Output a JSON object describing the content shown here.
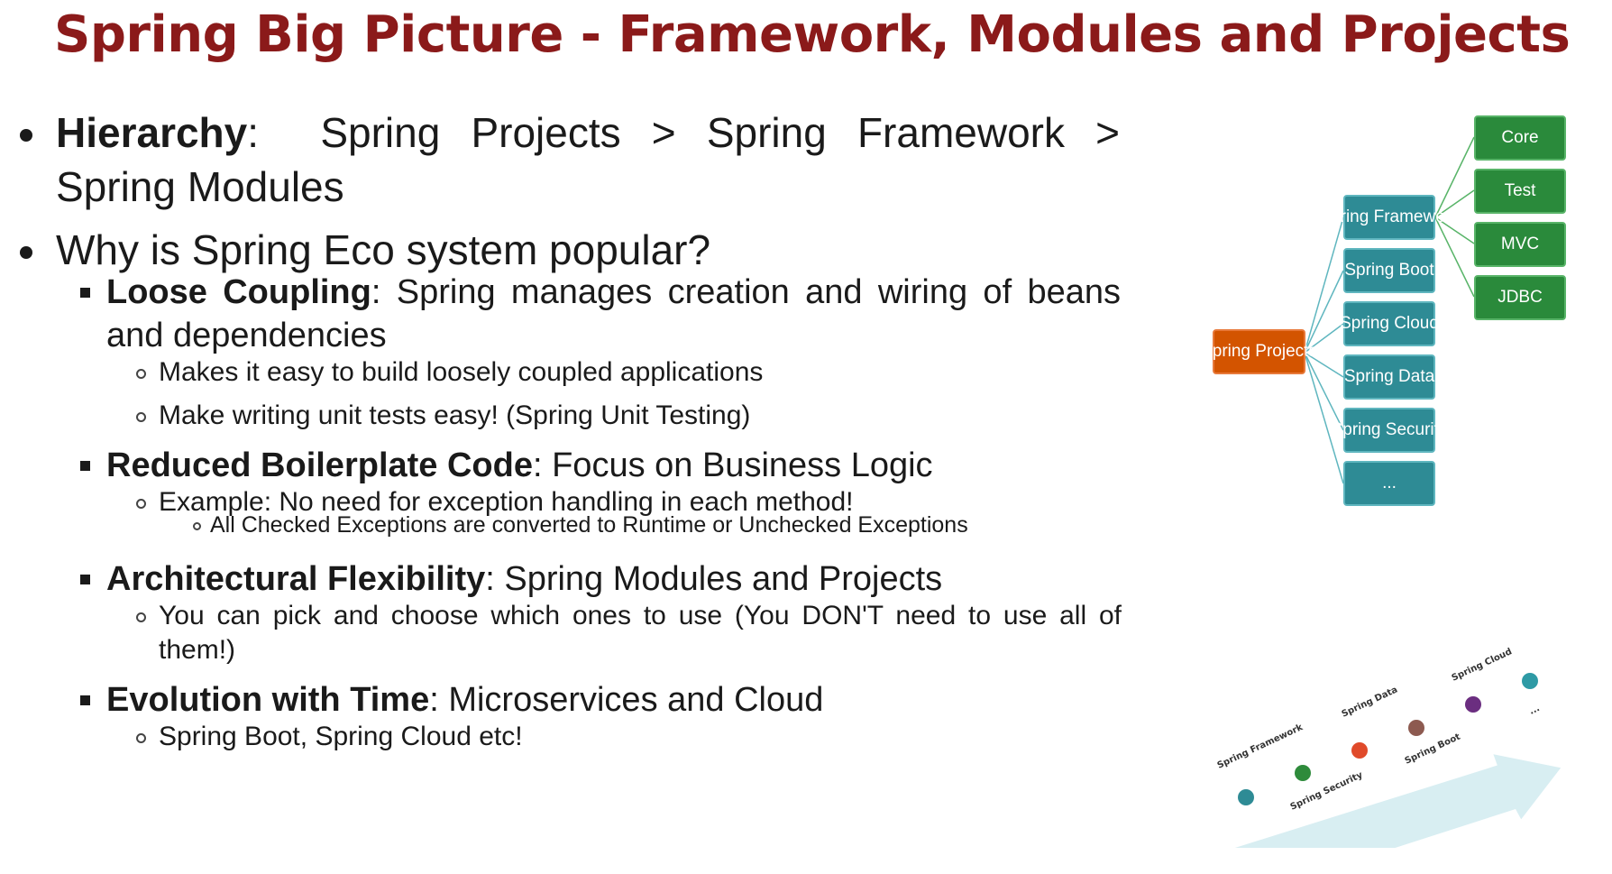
{
  "title": "Spring Big Picture - Framework, Modules and Projects",
  "bullets": {
    "hierarchy": {
      "label": "Hierarchy",
      "sep": ":",
      "line1": "Spring Projects > Spring Framework >",
      "line2": "Spring Modules"
    },
    "why": "Why is Spring Eco system popular?",
    "loose": {
      "label": "Loose Coupling",
      "line1": ": Spring manages creation and wiring of beans",
      "line2": "and dependencies",
      "sub1": "Makes it easy to build loosely coupled applications",
      "sub2": "Make writing unit tests easy! (Spring Unit Testing)"
    },
    "boilerplate": {
      "label": "Reduced Boilerplate Code",
      "text": ": Focus on Business Logic",
      "sub1": "Example: No need for exception handling in each method!",
      "sub1a": "All Checked Exceptions are converted to Runtime or Unchecked Exceptions"
    },
    "flex": {
      "label": "Architectural Flexibility",
      "text": ": Spring Modules and Projects",
      "sub1_line1": "You can pick and choose which ones to use (You DON'T need to use all of",
      "sub1_line2": "them!)"
    },
    "evolution": {
      "label": "Evolution with Time",
      "text": ": Microservices and Cloud",
      "sub1": "Spring Boot, Spring Cloud etc!"
    }
  },
  "diagram": {
    "root": "Spring Projects",
    "projects": [
      "Spring Framework",
      "Spring Boot",
      "Spring Cloud",
      "Spring Data",
      "Spring Security",
      "..."
    ],
    "modules": [
      "Core",
      "Test",
      "MVC",
      "JDBC"
    ],
    "colors": {
      "root": "#d35400",
      "project": "#2e8b95",
      "module": "#2a8a3b"
    }
  },
  "timeline": {
    "labels": [
      "Spring Framework",
      "Spring Security",
      "Spring Data",
      "Spring Boot",
      "Spring Cloud",
      "..."
    ],
    "dot_colors": [
      "#2e8b95",
      "#2e8b3b",
      "#e04a2a",
      "#8d5a50",
      "#6b2e80",
      "#2e9aa5"
    ]
  }
}
